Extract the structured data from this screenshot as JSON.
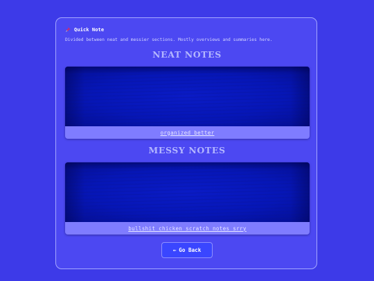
{
  "header": {
    "icon": "pushpin-icon",
    "title": "Quick Note",
    "subtitle": "Divided between neat and messier sections. Mostly overviews and summaries here."
  },
  "sections": [
    {
      "title": "NEAT NOTES",
      "caption": "organized better"
    },
    {
      "title": "MESSY NOTES",
      "caption": "bullshit chicken scratch notes srry"
    }
  ],
  "back_button": {
    "arrow": "←",
    "label": "Go Back"
  },
  "colors": {
    "page_bg": "#3d3ae8",
    "panel_bg": "#4c48f2",
    "card_image": "#0616b6",
    "caption_bar": "#7f7cff",
    "button_bg": "#3a46ff",
    "section_title": "#b3b6ff"
  }
}
